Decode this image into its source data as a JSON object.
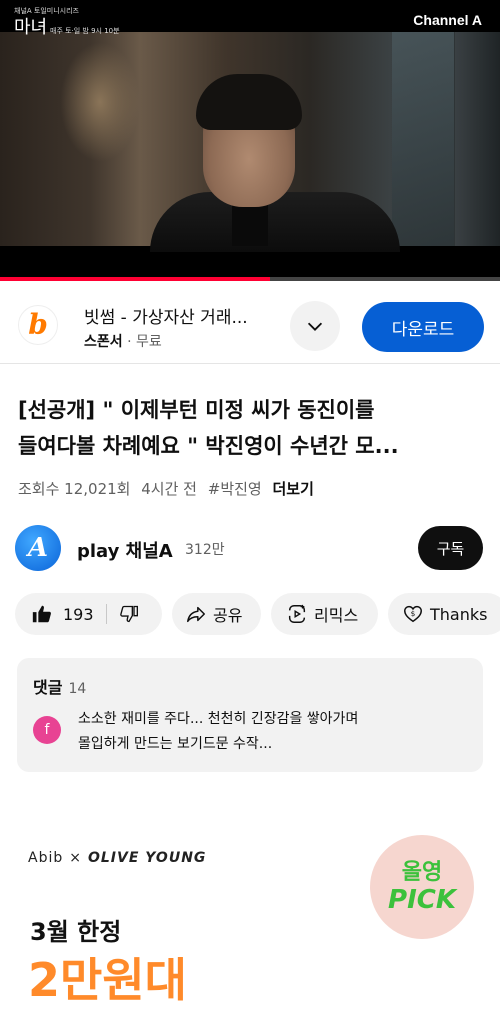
{
  "player": {
    "show_logo_small": "채널A 토일미니시리즈",
    "show_logo_title": "마녀",
    "show_schedule": "매주 토·일 밤 9시 10분",
    "channel_watermark": "Channel A",
    "progress_fraction": 0.54,
    "progress_color": "#ff0033"
  },
  "sponsor": {
    "logo_glyph": "b",
    "title": "빗썸 - 가상자산 거래...",
    "label": "스폰서",
    "price": "무료",
    "expand_icon": "chevron-down-icon",
    "download_label": "다운로드",
    "download_color": "#065fd4"
  },
  "video": {
    "title_line1": "[선공개] \" 이제부턴 미정 씨가 동진이를",
    "title_line2": "들여다볼 차례예요 \" 박진영이 수년간 모...",
    "views": "조회수 12,021회",
    "time_ago": "4시간 전",
    "hashtag": "#박진영",
    "more_label": "더보기"
  },
  "channel": {
    "avatar_glyph": "A",
    "name": "play 채널A",
    "subscribers": "312만",
    "subscribe_label": "구독"
  },
  "actions": {
    "like_count": "193",
    "share_label": "공유",
    "remix_label": "리믹스",
    "thanks_label": "Thanks"
  },
  "comments": {
    "heading": "댓글",
    "count": "14",
    "first_author_initial": "f",
    "first_text_line1": "소소한 재미를 주다...  천천히 긴장감을 쌓아가며",
    "first_text_line2": "몰입하게 만드는  보기드문 수작..."
  },
  "ad": {
    "brand_left": "Abib",
    "brand_sep": "×",
    "brand_right": "OLIVE YOUNG",
    "badge_line1": "올영",
    "badge_line2": "PICK",
    "limited": "3월 한정",
    "price": "2만원대"
  }
}
